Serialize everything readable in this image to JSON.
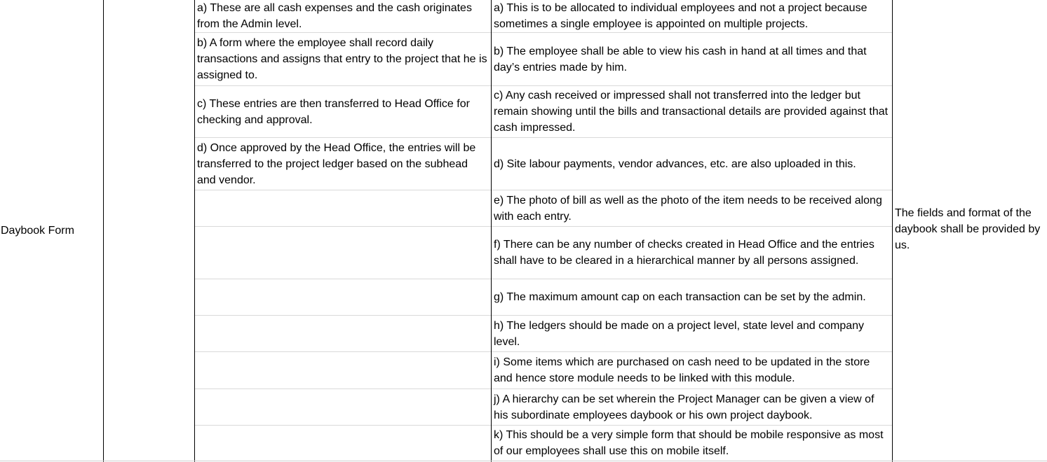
{
  "row_label": "Daybook Form",
  "process_points": [
    "a) These are all cash expenses and the cash originates from the Admin level.",
    "b) A form where the employee shall record daily transactions and assigns that entry to the project that he is assigned to.",
    "c) These entries are then transferred to Head Office for checking and approval.",
    "d) Once approved by the Head Office, the entries will be transferred to the project ledger based on the subhead and vendor."
  ],
  "requirements": [
    "a) This is to be allocated to individual employees and not a project because sometimes a single employee is appointed on multiple projects.",
    "b) The employee shall be able to view his cash in hand at all times and that day’s entries made by him.",
    "c) Any cash received or impressed shall not transferred into the ledger but remain showing until the bills and transactional details are provided against that cash impressed.",
    "d) Site labour payments, vendor advances, etc. are also uploaded in this.",
    "e) The photo of bill as well as the photo of the item needs to be received along with each entry.",
    "f) There can be any number of checks created in Head Office and the entries shall have to be cleared in a hierarchical manner by all persons assigned.",
    "g) The maximum amount cap on each transaction can be set by the admin.",
    "h) The ledgers should be made on a project level, state level and company level.",
    "i) Some items which are purchased on cash need to be updated in the store and hence store module needs to be linked with this module.",
    "j) A hierarchy can be set wherein the Project Manager can be given a view of his subordinate employees daybook or his own project daybook.",
    "k) This should be a very simple form that should be mobile responsive as most of our employees shall use this on mobile itself."
  ],
  "remarks": "The fields and format of the daybook shall be provided by us."
}
